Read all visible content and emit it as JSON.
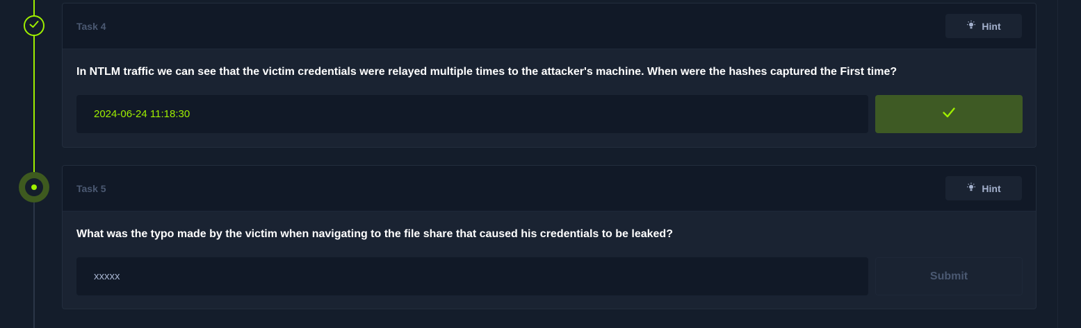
{
  "colors": {
    "accent": "#9fef00",
    "background": "#141d2b",
    "card": "#1a2332",
    "card_header": "#111927",
    "muted_text": "#4b5972",
    "hint_text": "#a4b1cd"
  },
  "timeline": {
    "nodes": [
      {
        "status": "completed",
        "icon": "check-icon"
      },
      {
        "status": "active",
        "icon": "dot-icon"
      }
    ]
  },
  "tasks": [
    {
      "title": "Task 4",
      "hint_label": "Hint",
      "hint_icon": "lightbulb-icon",
      "question": "In NTLM traffic we can see that the victim credentials were relayed multiple times to the attacker's machine. When were the hashes captured the First time?",
      "answer_value": "2024-06-24 11:18:30",
      "status": "correct",
      "submit_icon": "check-icon"
    },
    {
      "title": "Task 5",
      "hint_label": "Hint",
      "hint_icon": "lightbulb-icon",
      "question": "What was the typo made by the victim when navigating to the file share that caused his credentials to be leaked?",
      "answer_placeholder": "xxxxx",
      "status": "pending",
      "submit_label": "Submit"
    }
  ]
}
